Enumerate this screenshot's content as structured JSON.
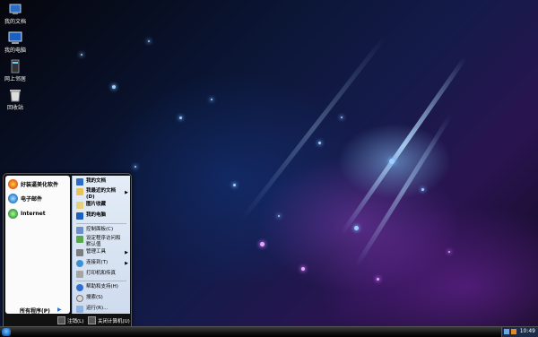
{
  "desktop_icons": [
    {
      "label": "我的文档",
      "icon": "my-documents-icon"
    },
    {
      "label": "我的电脑",
      "icon": "my-computer-icon"
    },
    {
      "label": "网上邻居",
      "icon": "network-places-icon"
    },
    {
      "label": "回收站",
      "icon": "recycle-bin-icon"
    }
  ],
  "start_menu": {
    "pinned": [
      {
        "label": "好装逼美化软件",
        "icon": "beautify-app-icon"
      },
      {
        "label": "电子邮件",
        "icon": "email-icon"
      },
      {
        "label": "Internet",
        "icon": "internet-icon"
      }
    ],
    "all_programs": "所有程序(P)",
    "right_items": [
      {
        "label": "我的文档",
        "icon": "my-documents-icon"
      },
      {
        "label": "我最近的文档(D)",
        "icon": "recent-documents-icon"
      },
      {
        "label": "图片收藏",
        "icon": "my-pictures-icon"
      },
      {
        "label": "我的电脑",
        "icon": "my-computer-icon"
      },
      {
        "label": "控制面板(C)",
        "icon": "control-panel-icon"
      },
      {
        "label": "设定程序访问和默认值",
        "icon": "program-defaults-icon"
      },
      {
        "label": "管理工具",
        "icon": "admin-tools-icon"
      },
      {
        "label": "连接到(T)",
        "icon": "connect-to-icon"
      },
      {
        "label": "打印机和传真",
        "icon": "printers-icon"
      },
      {
        "label": "帮助和支持(H)",
        "icon": "help-icon"
      },
      {
        "label": "搜索(S)",
        "icon": "search-icon"
      },
      {
        "label": "运行(R)...",
        "icon": "run-icon"
      }
    ],
    "logoff": "注销(L)",
    "shutdown": "关闭计算机(U)"
  },
  "taskbar": {
    "clock": "10:49"
  },
  "colors": {
    "taskbar": "#121212",
    "menu_right_pane": "#d9e4f3",
    "accent": "#2a6fd3"
  }
}
